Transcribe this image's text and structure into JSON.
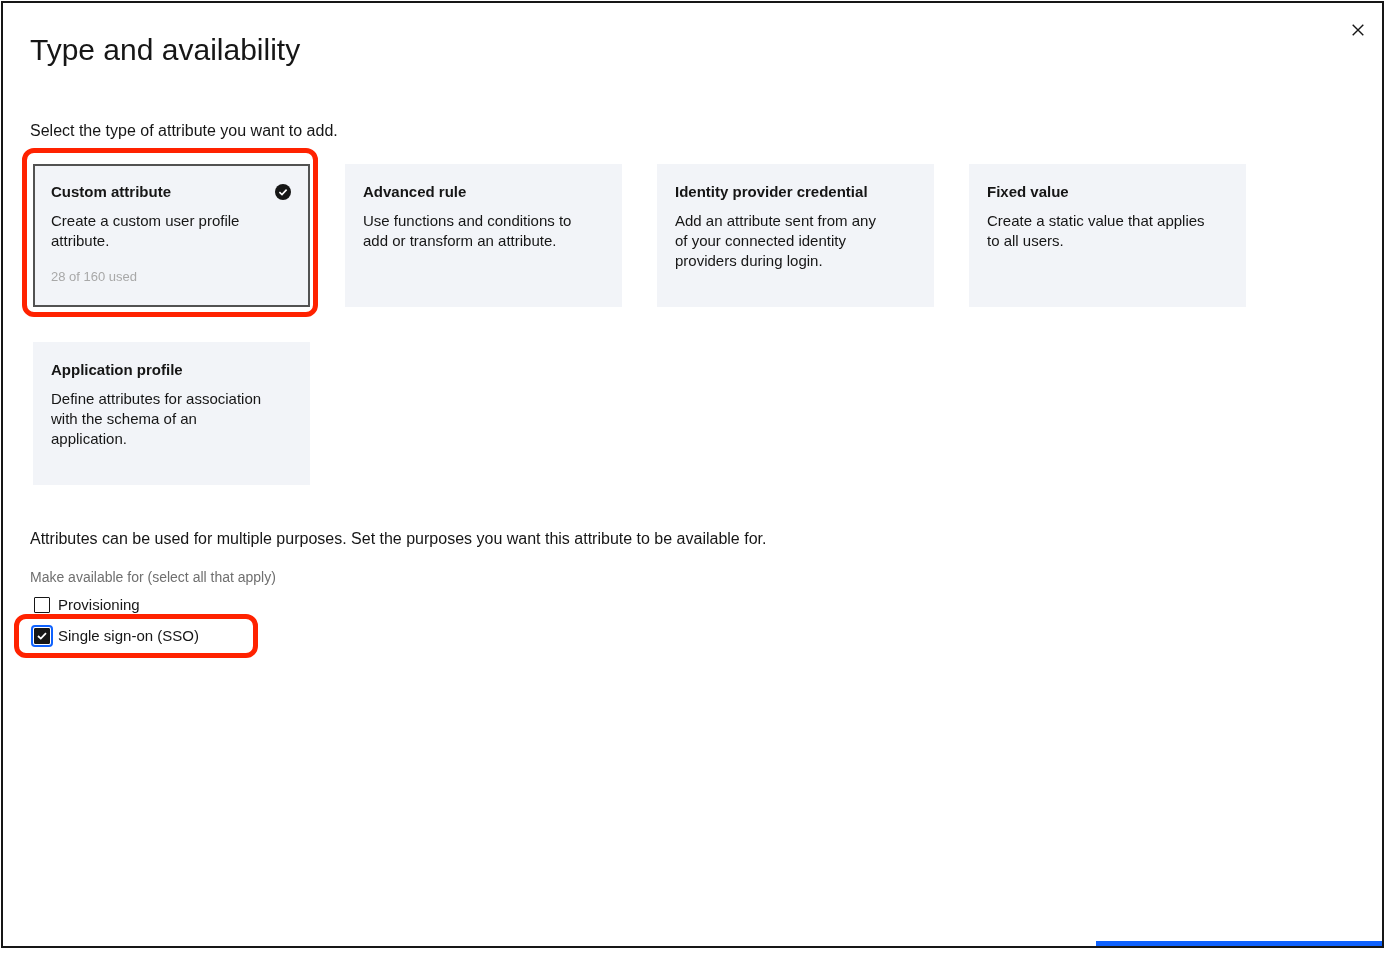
{
  "dialog": {
    "title": "Type and availability"
  },
  "type_prompt": "Select the type of attribute you want to add.",
  "types": [
    {
      "title": "Custom attribute",
      "description": "Create a custom user profile\nattribute.",
      "usage": "28 of 160 used",
      "selected": true,
      "highlighted": true
    },
    {
      "title": "Advanced rule",
      "description": "Use functions and conditions to\nadd or transform an attribute.",
      "selected": false,
      "highlighted": false
    },
    {
      "title": "Identity provider credential",
      "description": "Add an attribute sent from any\nof your connected identity\nproviders during login.",
      "selected": false,
      "highlighted": false
    },
    {
      "title": "Fixed value",
      "description": "Create a static value that applies\nto all users.",
      "selected": false,
      "highlighted": false
    },
    {
      "title": "Application profile",
      "description": "Define attributes for association\nwith the schema of an\napplication.",
      "selected": false,
      "highlighted": false
    }
  ],
  "purpose_note": "Attributes can be used for multiple purposes. Set the purposes you want this attribute to be available for.",
  "availability": {
    "label": "Make available for (select all that apply)",
    "options": [
      {
        "label": "Provisioning",
        "checked": false,
        "focused": false,
        "highlighted": false
      },
      {
        "label": "Single sign-on (SSO)",
        "checked": true,
        "focused": true,
        "highlighted": true
      }
    ]
  }
}
